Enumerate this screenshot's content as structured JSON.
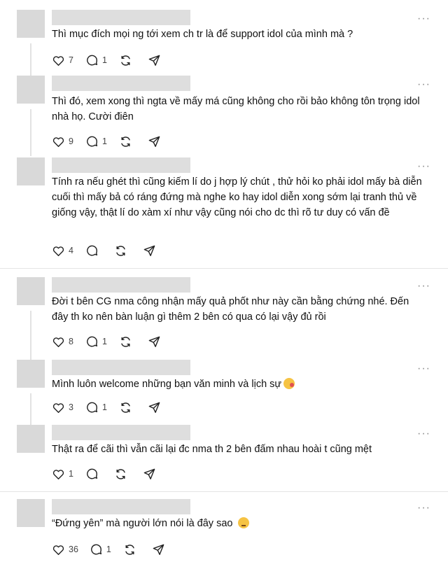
{
  "posts": [
    {
      "text": "Thì mục đích mọi ng tới xem ch tr là để support idol của mình mà ?",
      "likes": "7",
      "replies": "1"
    },
    {
      "text": "Thì đó, xem xong thì ngta về mấy má cũng không cho rồi bảo không tôn trọng idol nhà họ. Cười điên",
      "likes": "9",
      "replies": "1"
    },
    {
      "text": "Tính ra nếu ghét thì cũng kiếm lí do j hợp lý chút , thử hỏi ko phải idol mấy bà diễn cuối thì mấy bả có ráng đứng mà nghe ko hay idol diễn xong sớm lại tranh thủ về giống vậy, thật lí do xàm xí như vậy cũng nói cho dc thì rõ tư duy có vấn đề",
      "likes": "4",
      "replies": ""
    },
    {
      "text": "Đời t bên CG nma công nhận mấy quả phốt như này cần bằng chứng nhé. Đến đây th ko nên bàn luận gì thêm 2 bên có qua có lại vậy đủ rồi",
      "likes": "8",
      "replies": "1"
    },
    {
      "text": "Mình luôn welcome những bạn văn minh và lịch sự",
      "emoji": "face-blowing-kiss",
      "likes": "3",
      "replies": "1"
    },
    {
      "text": "Thật ra để cãi thì vẫn cãi lại đc nma th 2 bên đấm nhau hoài t cũng mệt",
      "likes": "1",
      "replies": ""
    },
    {
      "text": "“Đứng yên” mà người lớn nói là đây sao",
      "emoji": "pensive-face",
      "likes": "36",
      "replies": "1"
    }
  ],
  "icons": {
    "like": "heart-icon",
    "reply": "comment-icon",
    "repost": "repost-icon",
    "share": "send-icon",
    "more": "more-icon"
  },
  "more_glyph": "···",
  "colors": {
    "divider": "#e4e4e4",
    "placeholder": "#d9d9d9",
    "icon": "#222222"
  }
}
